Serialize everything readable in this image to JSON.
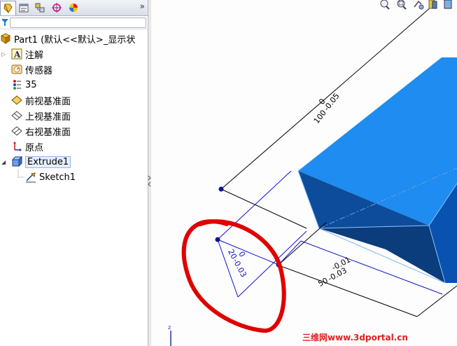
{
  "tree": {
    "root_label": "Part1 (默认<<默认>_显示状",
    "items": [
      {
        "label": "注解",
        "icon": "annotations-icon"
      },
      {
        "label": "传感器",
        "icon": "sensors-icon"
      },
      {
        "label": "35",
        "icon": "material-icon"
      },
      {
        "label": "前视基准面",
        "icon": "plane-icon"
      },
      {
        "label": "上视基准面",
        "icon": "plane-icon"
      },
      {
        "label": "右视基准面",
        "icon": "plane-icon"
      },
      {
        "label": "原点",
        "icon": "origin-icon"
      },
      {
        "label": "Extrude1",
        "icon": "extrude-icon"
      },
      {
        "label": "Sketch1",
        "icon": "sketch-icon"
      }
    ]
  },
  "toolbar": {
    "more": "»"
  },
  "dimensions": {
    "length_nominal": "100",
    "length_upper": "0",
    "length_lower": "-0.05",
    "width_nominal": "20",
    "width_upper": "0",
    "width_lower": "-0.03",
    "depth_nominal": "50",
    "depth_upper": "-0.01",
    "depth_lower": "-0.03"
  },
  "watermark": "三维网www.3dportal.cn",
  "triad_axis": "z",
  "colors": {
    "body": "#1e8cf0",
    "body_dark": "#0a3a78",
    "annotation_circle": "#e00000",
    "dimension_blue": "#1010d0"
  }
}
